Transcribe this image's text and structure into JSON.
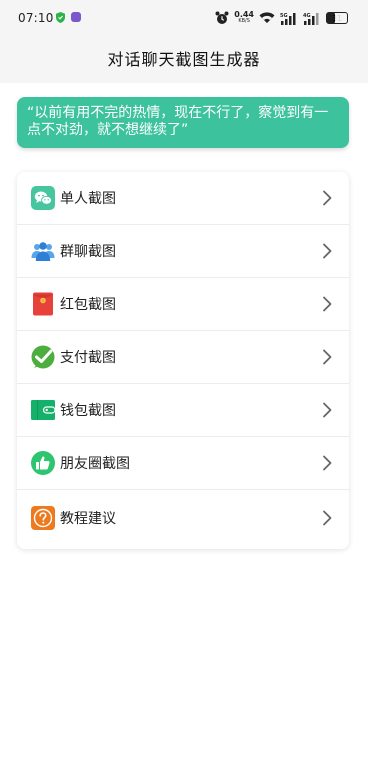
{
  "status_bar": {
    "time": "07:10",
    "speed_value": "0.44",
    "speed_unit": "KB/S",
    "net_label_1": "5G",
    "net_label_2": "4G",
    "battery_level": "31"
  },
  "header": {
    "title": "对话聊天截图生成器"
  },
  "quote": {
    "text": "“以前有用不完的热情，现在不行了，察觉到有一点不对劲，就不想继续了”"
  },
  "menu": {
    "items": [
      {
        "label": "单人截图",
        "icon": "wechat-chat-icon",
        "color": "#47c59e"
      },
      {
        "label": "群聊截图",
        "icon": "group-people-icon",
        "color": "#2f7fd6"
      },
      {
        "label": "红包截图",
        "icon": "red-packet-icon",
        "color": "#e8413b"
      },
      {
        "label": "支付截图",
        "icon": "payment-check-icon",
        "color": "#4cae3e"
      },
      {
        "label": "钱包截图",
        "icon": "wallet-icon",
        "color": "#15b06a"
      },
      {
        "label": "朋友圈截图",
        "icon": "thumbs-up-icon",
        "color": "#2fc46f"
      },
      {
        "label": "教程建议",
        "icon": "question-icon",
        "color": "#ee7a1f"
      }
    ]
  }
}
